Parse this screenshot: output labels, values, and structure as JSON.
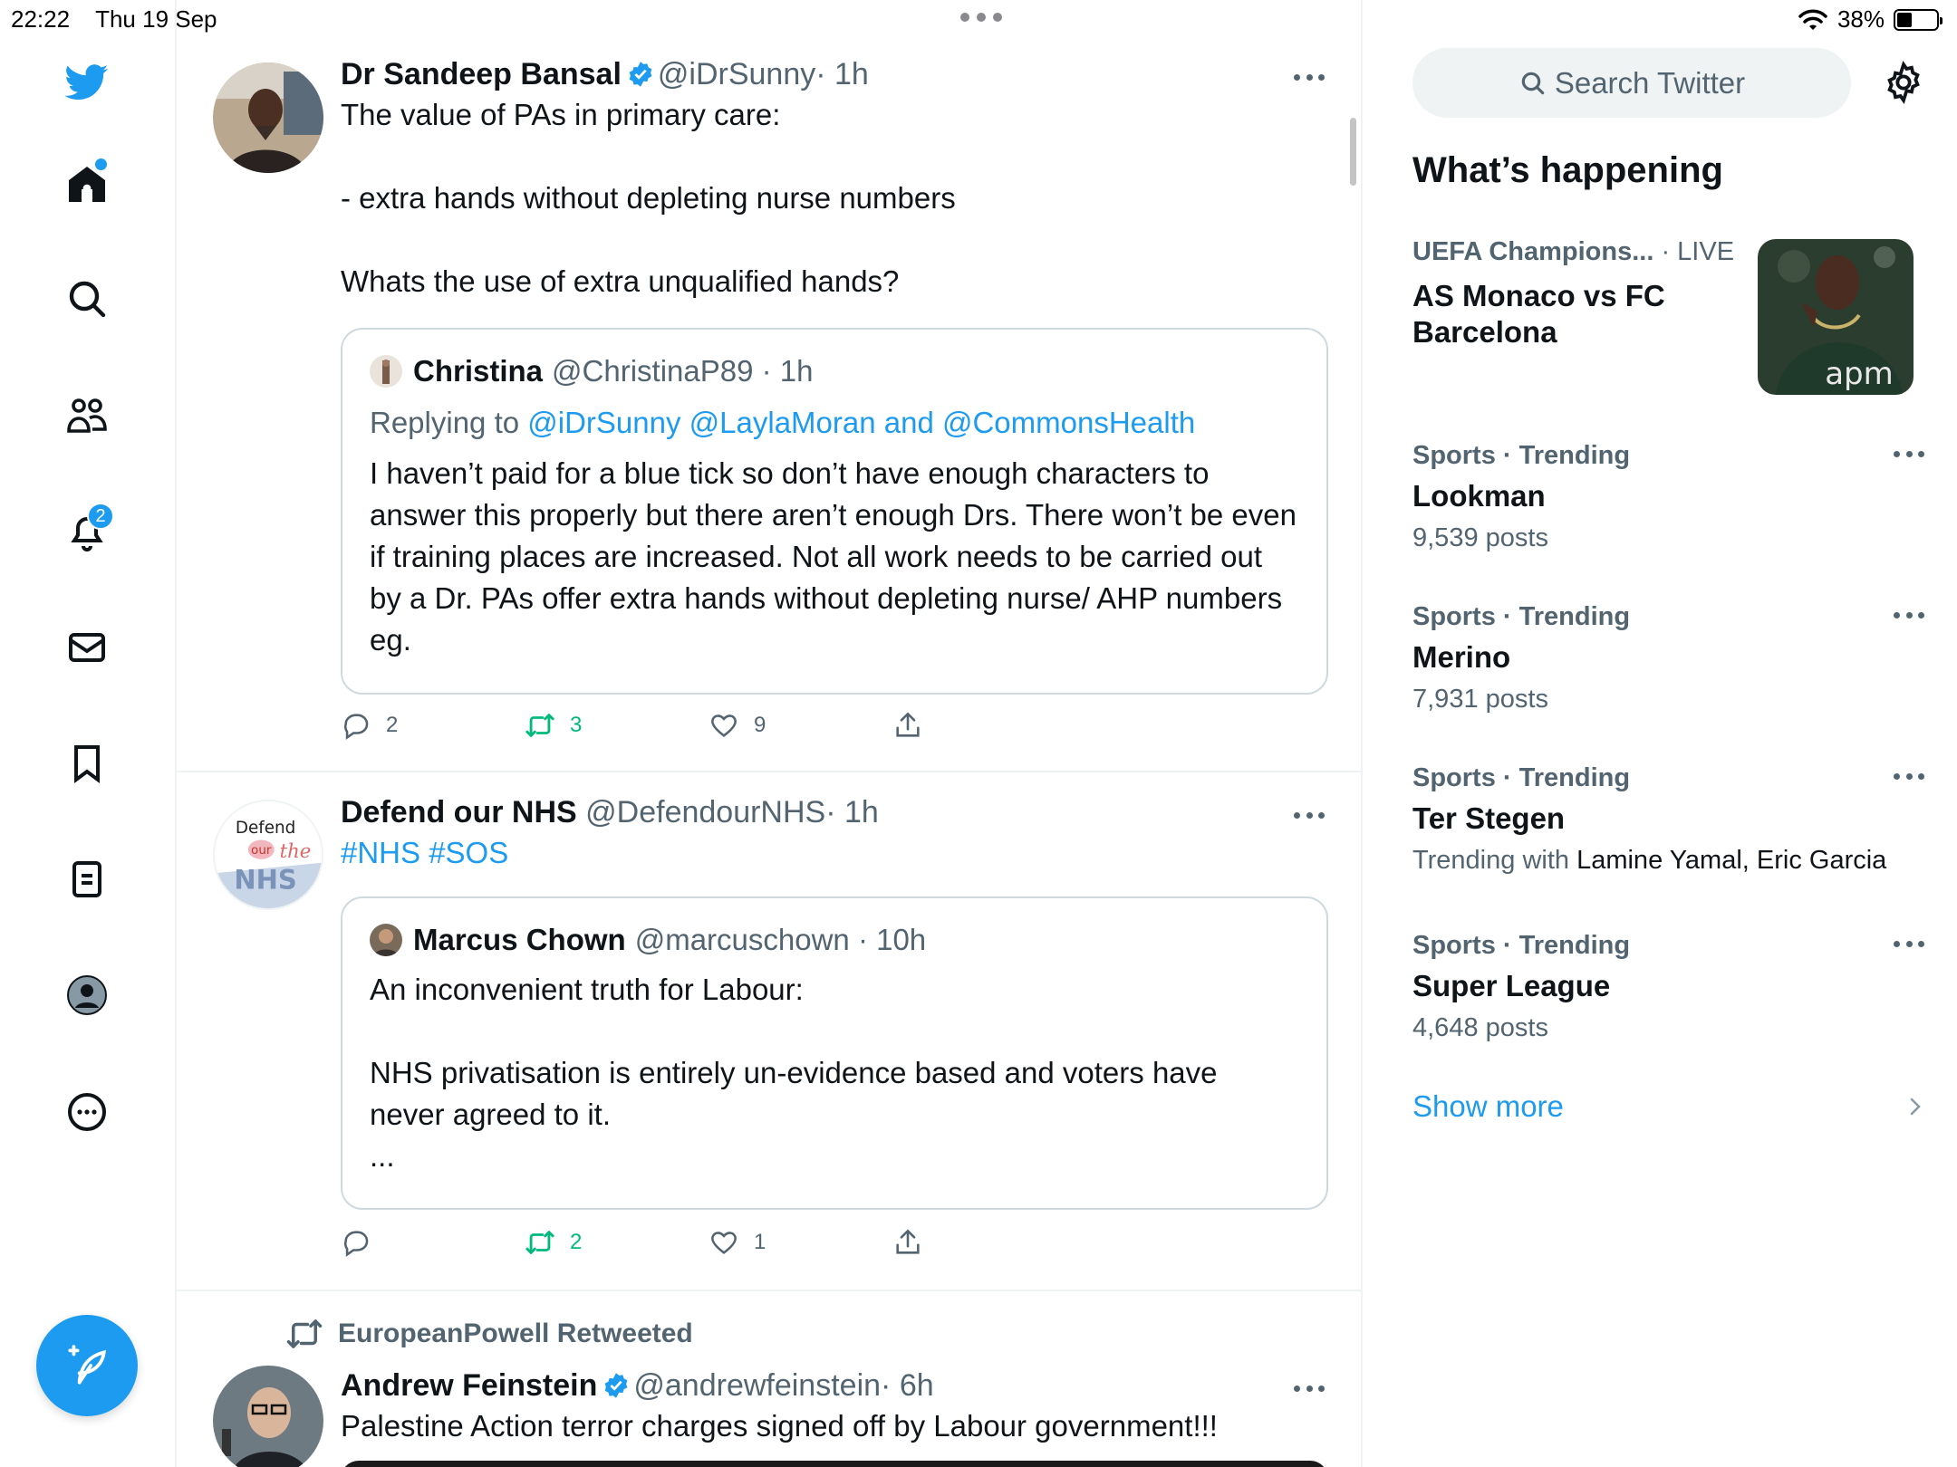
{
  "status_bar": {
    "time": "22:22",
    "date": "Thu 19 Sep",
    "battery": "38%",
    "battery_level": 0.38
  },
  "nav": {
    "notifications_badge": "2"
  },
  "tweets": [
    {
      "name": "Dr Sandeep Bansal",
      "handle": "@iDrSunny",
      "time": "· 1h",
      "text": "The value of PAs in primary care:\n\n- extra hands without depleting nurse numbers\n\nWhats the use of extra unqualified hands?",
      "quote": {
        "name": "Christina",
        "handle": "@ChristinaP89 · 1h",
        "replying_prefix": "Replying to ",
        "replying_links": "@iDrSunny @LaylaMoran and @CommonsHealth",
        "text": "I haven’t paid for a blue tick so don’t have enough characters to answer this properly but there aren’t enough Drs. There won’t be even if training places are increased. Not all work needs to be carried out by a Dr. PAs offer extra hands without depleting nurse/ AHP numbers eg."
      },
      "replies": "2",
      "retweets": "3",
      "likes": "9"
    },
    {
      "name": "Defend our NHS",
      "handle": "@DefendourNHS",
      "time": "· 1h",
      "avatar_text": {
        "line1": "Defend",
        "line2": "our",
        "line3": "the",
        "line4": "NHS"
      },
      "text": "#NHS #SOS",
      "quote": {
        "name": "Marcus Chown",
        "handle": "@marcuschown · 10h",
        "text": "An inconvenient truth for Labour:\n\nNHS privatisation is entirely un-evidence based and voters have never agreed to it.\n..."
      },
      "replies": "",
      "retweets": "2",
      "likes": "1"
    },
    {
      "retweeted_by": "EuropeanPowell Retweeted",
      "name": "Andrew Feinstein",
      "handle": "@andrewfeinstein",
      "time": "· 6h",
      "text": "Palestine Action terror charges signed off by Labour government!!!"
    }
  ],
  "right": {
    "search_placeholder": "Search Twitter",
    "section_title": "What’s happening",
    "event": {
      "category": "UEFA Champions...",
      "live": "· LIVE",
      "title": "AS Monaco vs FC Barcelona",
      "image_logo_text": "apm"
    },
    "trends": [
      {
        "meta": "Sports · Trending",
        "name": "Lookman",
        "sub": "9,539 posts"
      },
      {
        "meta": "Sports · Trending",
        "name": "Merino",
        "sub": "7,931 posts"
      },
      {
        "meta": "Sports · Trending",
        "name": "Ter Stegen",
        "sub_prefix": "Trending with ",
        "sub_names": "Lamine Yamal, Eric Garcia"
      },
      {
        "meta": "Sports · Trending",
        "name": "Super League",
        "sub": "4,648 posts"
      }
    ],
    "show_more": "Show more"
  },
  "colors": {
    "accent": "#1d9bf0",
    "retweet": "#00ba7c",
    "secondary_text": "#536471",
    "border": "#cfd9de"
  }
}
